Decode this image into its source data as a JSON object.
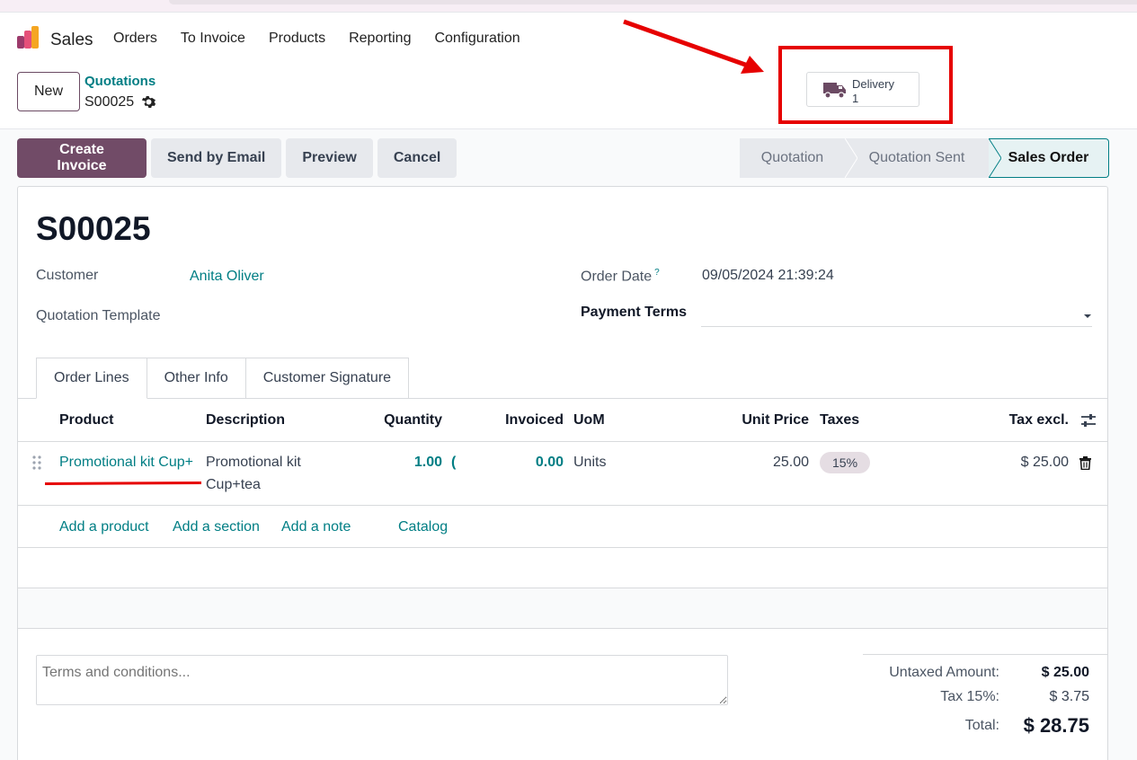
{
  "app": {
    "name": "Sales"
  },
  "menu": [
    "Orders",
    "To Invoice",
    "Products",
    "Reporting",
    "Configuration"
  ],
  "control": {
    "new_label": "New",
    "breadcrumb_parent": "Quotations",
    "breadcrumb_current": "S00025"
  },
  "smart_button": {
    "label": "Delivery",
    "count": "1",
    "icon": "truck-icon"
  },
  "actions": {
    "create_invoice": "Create Invoice",
    "send_email": "Send by Email",
    "preview": "Preview",
    "cancel": "Cancel"
  },
  "statusbar": {
    "stages": [
      "Quotation",
      "Quotation Sent",
      "Sales Order"
    ],
    "active": "Sales Order"
  },
  "form": {
    "title": "S00025",
    "customer_label": "Customer",
    "customer_value": "Anita Oliver",
    "template_label": "Quotation Template",
    "order_date_label": "Order Date",
    "order_date_help": "?",
    "order_date_value": "09/05/2024 21:39:24",
    "payment_terms_label": "Payment Terms"
  },
  "tabs": [
    "Order Lines",
    "Other Info",
    "Customer Signature"
  ],
  "table": {
    "headers": {
      "product": "Product",
      "description": "Description",
      "quantity": "Quantity",
      "invoiced": "Invoiced",
      "uom": "UoM",
      "unit_price": "Unit Price",
      "taxes": "Taxes",
      "tax_excl": "Tax excl."
    },
    "rows": [
      {
        "product": "Promotional kit Cup+",
        "description_1": "Promotional kit",
        "description_2": "Cup+tea",
        "quantity": "1.00",
        "quantity_tail": "(",
        "invoiced": "0.00",
        "uom": "Units",
        "unit_price": "25.00",
        "tax": "15%",
        "tax_excl": "$ 25.00"
      }
    ],
    "adders": [
      "Add a product",
      "Add a section",
      "Add a note",
      "Catalog"
    ]
  },
  "terms_placeholder": "Terms and conditions...",
  "totals": {
    "untaxed_label": "Untaxed Amount:",
    "untaxed_value": "$ 25.00",
    "tax_label": "Tax 15%:",
    "tax_value": "$ 3.75",
    "total_label": "Total:",
    "total_value": "$ 28.75"
  },
  "colors": {
    "primary": "#714b67",
    "link": "#017e84",
    "annotation": "#e60000"
  }
}
